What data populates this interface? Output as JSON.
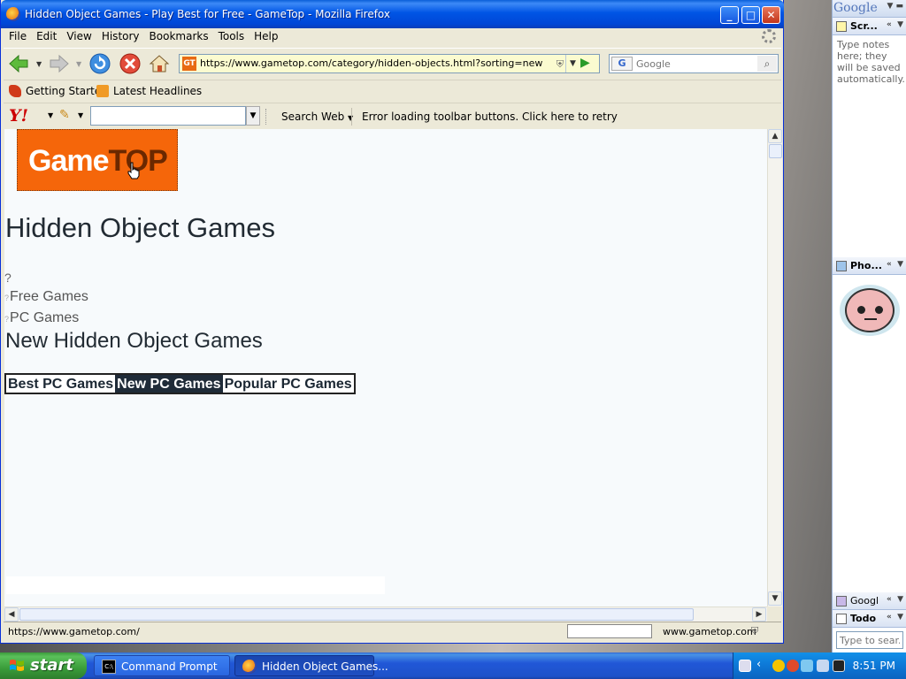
{
  "window": {
    "title": "Hidden Object Games - Play Best for Free - GameTop - Mozilla Firefox",
    "controls": {
      "minimize": "_",
      "maximize": "□",
      "close": "✕"
    }
  },
  "menu": [
    "File",
    "Edit",
    "View",
    "History",
    "Bookmarks",
    "Tools",
    "Help"
  ],
  "nav": {
    "url": "https://www.gametop.com/category/hidden-objects.html?sorting=new",
    "site_icon_label": "GT",
    "search_placeholder": "Google",
    "search_engine_label": "G"
  },
  "bookmarks": [
    "Getting Started",
    "Latest Headlines"
  ],
  "yahoo_toolbar": {
    "logo": "Y!",
    "search_web_label": "Search Web",
    "error_text": "Error loading toolbar buttons. Click here to retry"
  },
  "page": {
    "logo": {
      "part1": "Game",
      "part2": "TOP"
    },
    "title": "Hidden Object Games",
    "bullet": "?",
    "links": [
      "Free Games",
      "PC Games"
    ],
    "link_marker": "?",
    "subtitle": "New Hidden Object Games",
    "tabs": [
      {
        "label": "Best PC Games",
        "active": false
      },
      {
        "label": "New PC Games",
        "active": true
      },
      {
        "label": "Popular PC Games",
        "active": false
      }
    ]
  },
  "status": {
    "text": "https://www.gametop.com/",
    "domain": "www.gametop.com"
  },
  "sidebar": {
    "logo": "Google",
    "scratch_title": "Scr...",
    "scratch_note": "Type notes here; they will be saved automatically.",
    "photo_title": "Pho...",
    "google_gadget_title": "Googl",
    "todo_title": "Todo",
    "search_placeholder": "Type to sear..."
  },
  "taskbar": {
    "start_label": "start",
    "tasks": [
      {
        "label": "Command Prompt",
        "active": false
      },
      {
        "label": "Hidden Object Games...",
        "active": true
      }
    ],
    "clock": "8:51 PM"
  },
  "colors": {
    "logo_orange": "#f5660a",
    "logo_top_brown": "#6b2800",
    "tab_dark": "#1f2b38",
    "xp_blue": "#0055e5",
    "start_green": "#3a9c3a"
  }
}
